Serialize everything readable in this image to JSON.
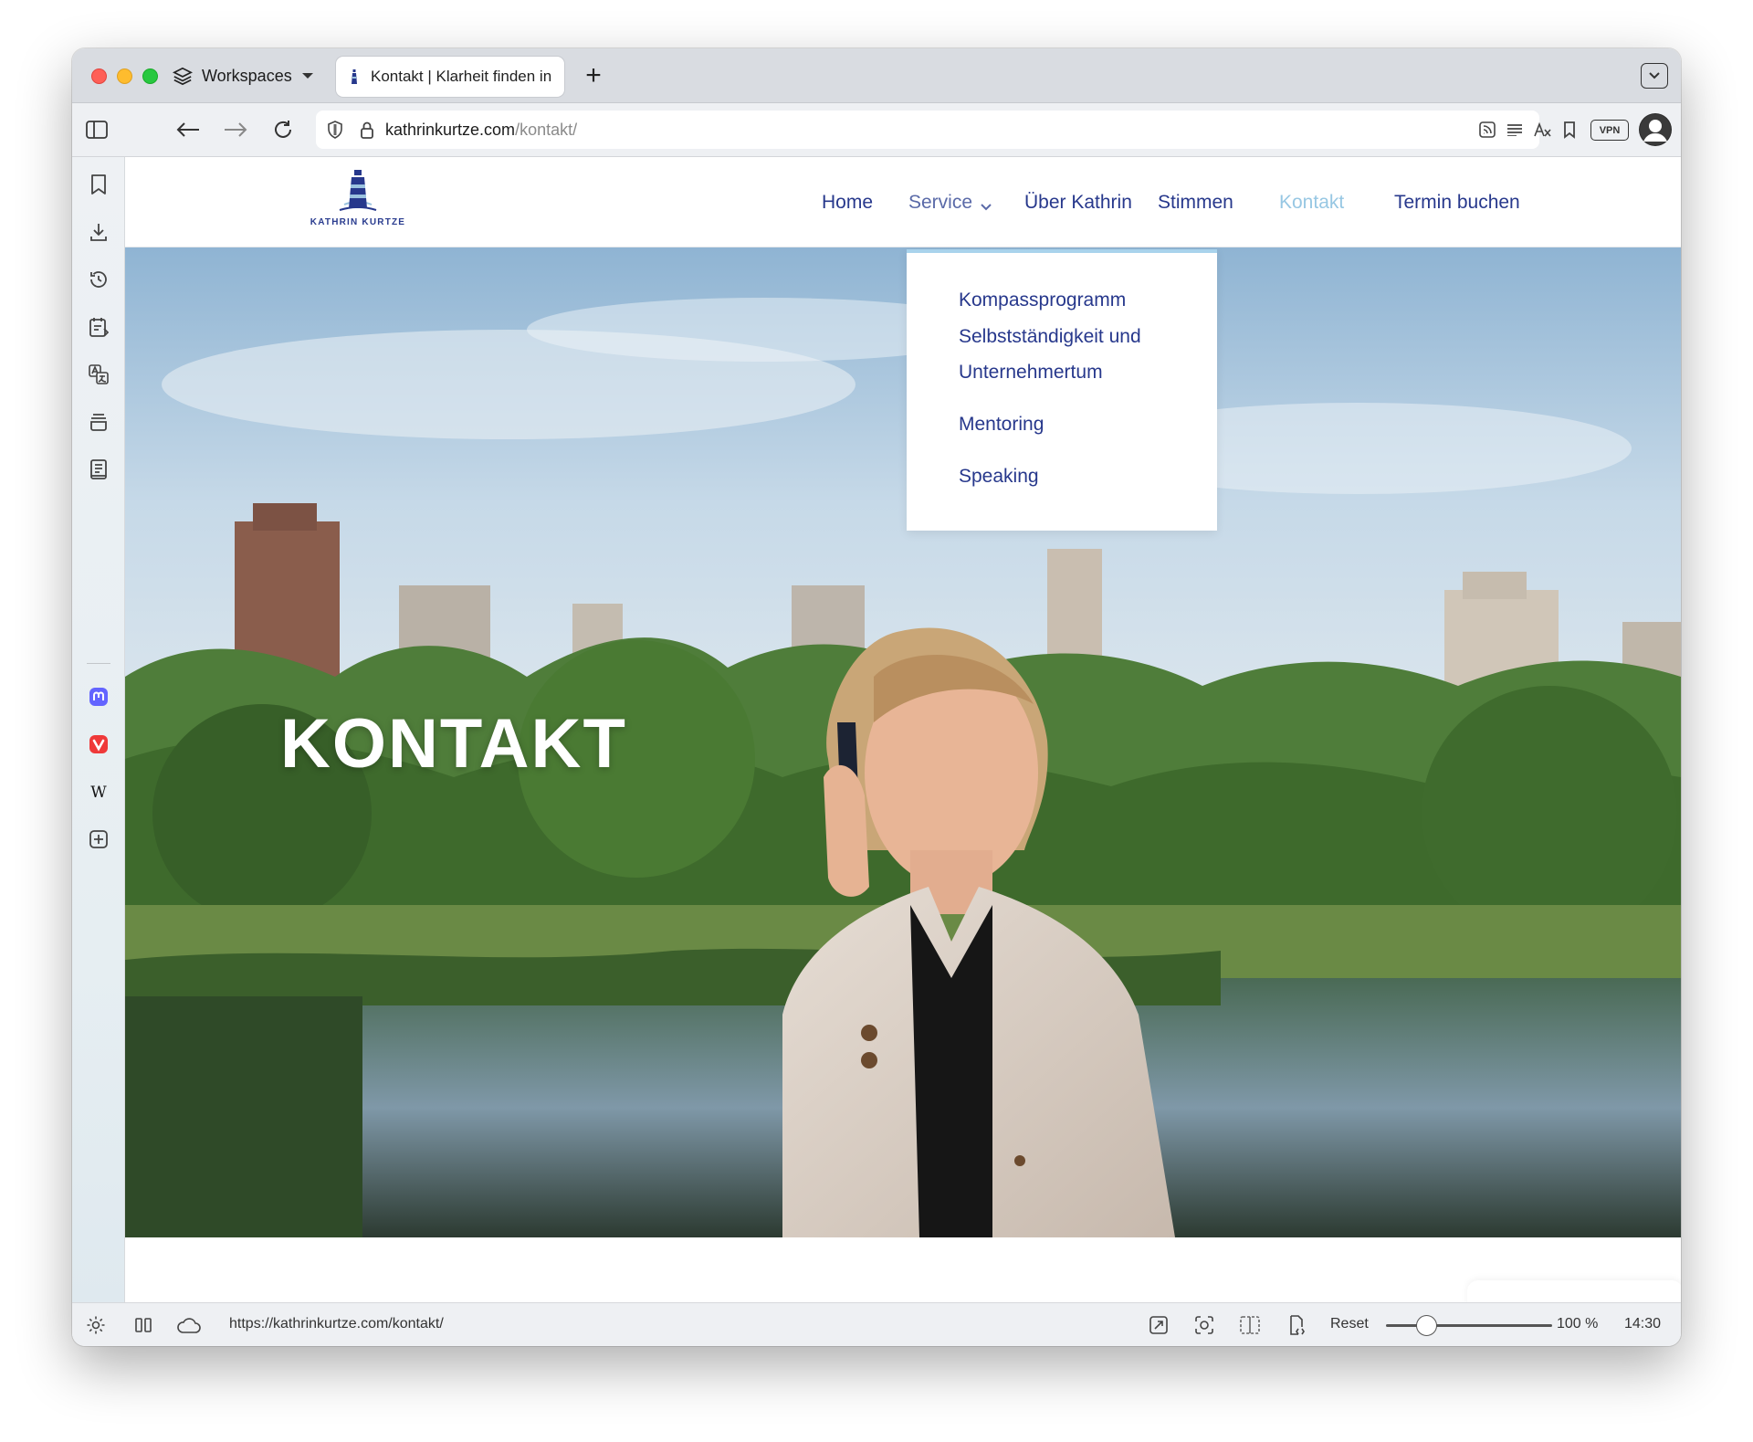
{
  "browser": {
    "workspaces_label": "Workspaces",
    "tab_title": "Kontakt | Klarheit finden in",
    "url_host": "kathrinkurtze.com",
    "url_path": "/kontakt/",
    "vpn_label": "VPN",
    "status_url": "https://kathrinkurtze.com/kontakt/",
    "reset_label": "Reset",
    "zoom_level": "100 %",
    "zoom_fraction": 0.25,
    "clock": "14:30"
  },
  "site": {
    "logo_text": "KATHRIN KURTZE",
    "nav": {
      "home": "Home",
      "service": "Service",
      "about": "Über Kathrin",
      "voices": "Stimmen",
      "contact": "Kontakt",
      "booking": "Termin buchen"
    },
    "dropdown": {
      "item1": "Kompassprogramm",
      "item2a": "Selbstständigkeit und",
      "item2b": "Unternehmertum",
      "item3": "Mentoring",
      "item4": "Speaking"
    },
    "hero_title": "KONTAKT"
  },
  "colors": {
    "nav_link": "#27388c",
    "nav_active": "#97c7e3",
    "dropdown_accent": "#a9d3ec"
  },
  "icons": {
    "sidebar": [
      "bookmarks-icon",
      "downloads-icon",
      "history-icon",
      "notes-icon",
      "translate-icon",
      "window-stack-icon",
      "reading-list-icon",
      "mastodon-icon",
      "vivaldi-icon",
      "wikipedia-icon",
      "add-panel-icon"
    ],
    "toolbar": [
      "panel-toggle-icon",
      "back-icon",
      "forward-icon",
      "reload-icon",
      "shield-icon",
      "lock-icon",
      "feed-icon",
      "reader-view-icon",
      "translate-icon",
      "bookmark-icon",
      "profile-avatar-icon"
    ]
  }
}
